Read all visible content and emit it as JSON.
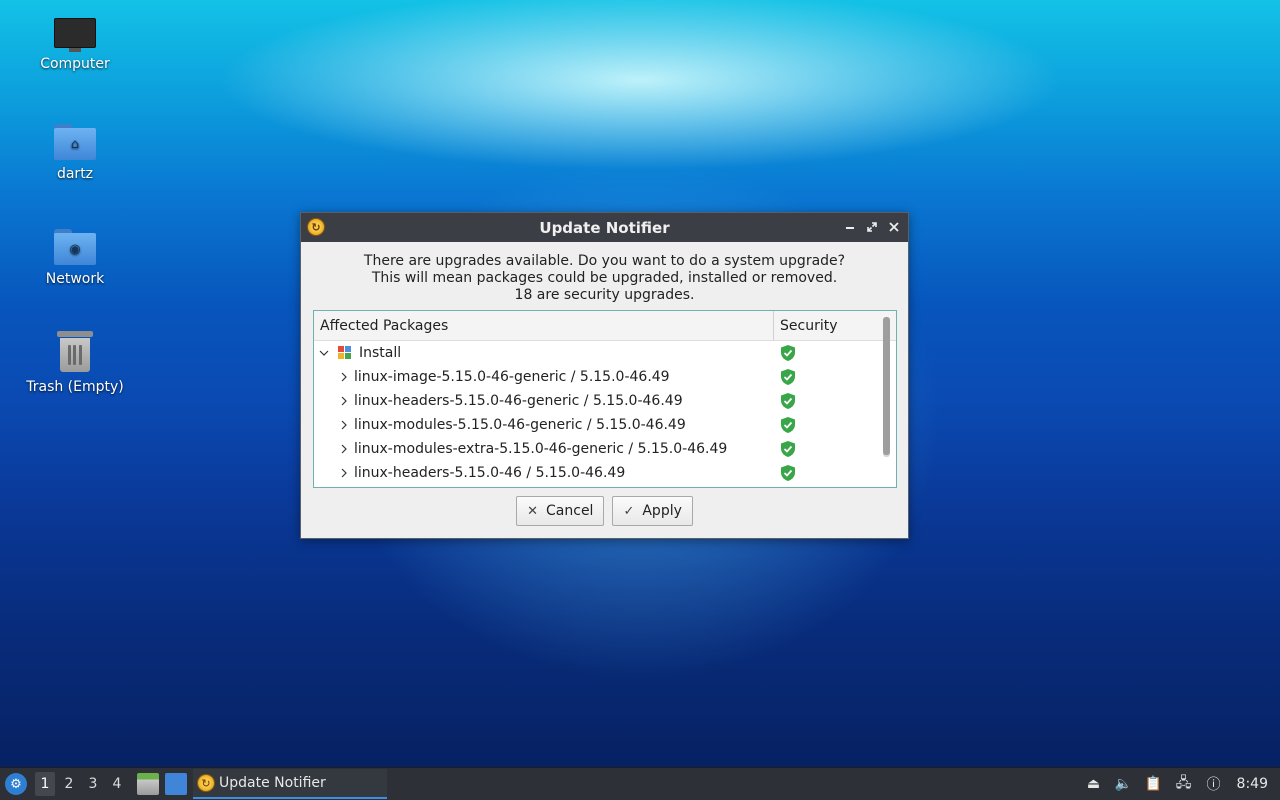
{
  "desktop": {
    "icons": [
      {
        "label": "Computer",
        "icon": "computer-icon"
      },
      {
        "label": "dartz",
        "icon": "home-folder-icon"
      },
      {
        "label": "Network",
        "icon": "network-folder-icon"
      },
      {
        "label": "Trash (Empty)",
        "icon": "trash-icon"
      }
    ]
  },
  "dialog": {
    "title": "Update Notifier",
    "message_lines": [
      "There are upgrades available. Do you want to do a system upgrade?",
      "This will mean packages could be upgraded, installed or removed.",
      "18 are security upgrades."
    ],
    "columns": [
      "Affected Packages",
      "Security"
    ],
    "group": {
      "label": "Install",
      "expanded": true,
      "security": "shield-check-icon"
    },
    "packages": [
      {
        "name": "linux-image-5.15.0-46-generic",
        "version": "5.15.0-46.49",
        "security": "shield-check-icon"
      },
      {
        "name": "linux-headers-5.15.0-46-generic",
        "version": "5.15.0-46.49",
        "security": "shield-check-icon"
      },
      {
        "name": "linux-modules-5.15.0-46-generic",
        "version": "5.15.0-46.49",
        "security": "shield-check-icon"
      },
      {
        "name": "linux-modules-extra-5.15.0-46-generic",
        "version": "5.15.0-46.49",
        "security": "shield-check-icon"
      },
      {
        "name": "linux-headers-5.15.0-46",
        "version": "5.15.0-46.49",
        "security": "shield-check-icon"
      }
    ],
    "buttons": {
      "cancel": "Cancel",
      "apply": "Apply"
    }
  },
  "taskbar": {
    "workspaces": [
      "1",
      "2",
      "3",
      "4"
    ],
    "active_workspace": "1",
    "task_label": "Update Notifier",
    "clock": "8:49"
  },
  "colors": {
    "titlebar": "#3b3e44",
    "taskbar": "#2d3036",
    "shield": "#3aa64a",
    "accent": "#3c8ee0"
  }
}
